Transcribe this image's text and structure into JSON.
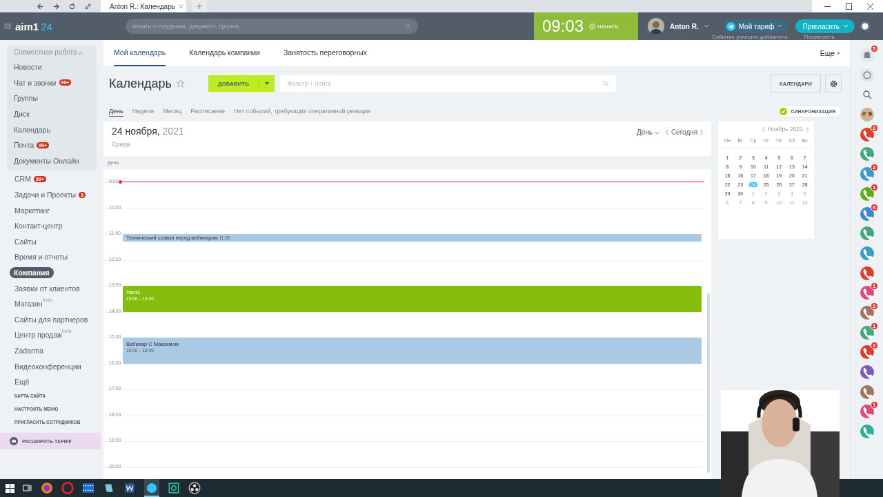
{
  "browser": {
    "tab_title": "Anton R.: Календарь"
  },
  "header": {
    "logo": "aim1",
    "logo_suffix": "24",
    "search_placeholder": "искать сотрудника, документ, прочее...",
    "timer": "09:03",
    "timer_action": "НАЧАТЬ",
    "user": "Anton R.",
    "tariff": "Мой тариф",
    "invite": "Пригласить",
    "toast": "Событие успешно добавлено",
    "toast_link": "Посмотреть"
  },
  "sidebar": {
    "group_title": "Совместная работа",
    "items": [
      {
        "label": "Новости",
        "selected": false,
        "in_group": true
      },
      {
        "label": "Чат и звонки",
        "badge": "99+",
        "selected": false,
        "in_group": true
      },
      {
        "label": "Группы",
        "selected": false,
        "in_group": true
      },
      {
        "label": "Диск",
        "selected": false,
        "in_group": true
      },
      {
        "label": "Календарь",
        "selected": false,
        "in_group": true
      },
      {
        "label": "Почта",
        "badge": "99+",
        "selected": false,
        "in_group": true
      },
      {
        "label": "Документы Онлайн",
        "selected": false,
        "in_group": true
      },
      {
        "label": "CRM",
        "badge": "99+",
        "selected": false,
        "in_group": false
      },
      {
        "label": "Задачи и Проекты",
        "badge": "3",
        "selected": false,
        "in_group": false
      },
      {
        "label": "Маркетинг",
        "selected": false,
        "in_group": false
      },
      {
        "label": "Контакт-центр",
        "selected": false,
        "in_group": false
      },
      {
        "label": "Сайты",
        "selected": false,
        "in_group": false
      },
      {
        "label": "Время и отчеты",
        "selected": false,
        "in_group": false
      },
      {
        "label": "Компания",
        "selected": true,
        "in_group": false
      },
      {
        "label": "Заявки от клиентов",
        "selected": false,
        "in_group": false
      },
      {
        "label": "Магазин",
        "tag": "beta",
        "selected": false,
        "in_group": false
      },
      {
        "label": "Сайты для партнеров",
        "selected": false,
        "in_group": false
      },
      {
        "label": "Центр продаж",
        "tag": "beta",
        "selected": false,
        "in_group": false
      },
      {
        "label": "Zadarma",
        "selected": false,
        "in_group": false
      },
      {
        "label": "Видеоконференции",
        "selected": false,
        "in_group": false
      },
      {
        "label": "Ещё",
        "selected": false,
        "in_group": false
      }
    ],
    "links": [
      "КАРТА САЙТА",
      "НАСТРОИТЬ МЕНЮ",
      "ПРИГЛАСИТЬ СОТРУДНИКОВ"
    ],
    "upgrade": "РАСШИРИТЬ ТАРИФ"
  },
  "tabs": [
    {
      "label": "Мой календарь",
      "selected": true
    },
    {
      "label": "Календарь компании",
      "selected": false
    },
    {
      "label": "Занятость переговорных",
      "selected": false
    }
  ],
  "more": "Еще",
  "toolbar": {
    "title": "Календарь",
    "add": "ДОБАВИТЬ",
    "filter_placeholder": "Фильтр + поиск",
    "calendars": "КАЛЕНДАРИ"
  },
  "views": [
    {
      "label": "День",
      "selected": true
    },
    {
      "label": "Неделя",
      "selected": false
    },
    {
      "label": "Месяц",
      "selected": false
    },
    {
      "label": "Расписание",
      "selected": false
    }
  ],
  "notice": "Нет событий, требующих оперативной реакции",
  "sync": "СИНХРОНИЗАЦИЯ",
  "day": {
    "date": "24 ноября,",
    "year": "2021",
    "weekday": "Среда",
    "view": "День",
    "today": "Сегодня",
    "section": "День",
    "hours": [
      "9:00",
      "10:00",
      "11:00",
      "12:00",
      "13:00",
      "14:00",
      "15:00",
      "16:00",
      "17:00",
      "18:00",
      "19:00",
      "20:00"
    ],
    "events": [
      {
        "title": "Технический созвон перед вебинаром",
        "time": "11:00",
        "color": "#a9c9e5"
      },
      {
        "title": "Тест1",
        "time": "13:00 – 14:00",
        "color": "#85bd0b"
      },
      {
        "title": "Вебинар С Максимом",
        "time": "15:00 – 16:00",
        "color": "#a9c9e5"
      }
    ]
  },
  "mini_calendar": {
    "month": "Ноябрь 2021",
    "weekdays": [
      "Пн",
      "Вт",
      "Ср",
      "Чт",
      "Пт",
      "Сб",
      "Вс"
    ],
    "weeks": [
      [
        {
          "day": "1",
          "other_month": false,
          "selected": false
        },
        {
          "day": "2",
          "other_month": false,
          "selected": false
        },
        {
          "day": "3",
          "other_month": false,
          "selected": false
        },
        {
          "day": "4",
          "other_month": false,
          "selected": false
        },
        {
          "day": "5",
          "other_month": false,
          "selected": false
        },
        {
          "day": "6",
          "other_month": false,
          "selected": false
        },
        {
          "day": "7",
          "other_month": false,
          "selected": false
        }
      ],
      [
        {
          "day": "8",
          "other_month": false,
          "selected": false
        },
        {
          "day": "9",
          "other_month": false,
          "selected": false
        },
        {
          "day": "10",
          "other_month": false,
          "selected": false
        },
        {
          "day": "11",
          "other_month": false,
          "selected": false
        },
        {
          "day": "12",
          "other_month": false,
          "selected": false
        },
        {
          "day": "13",
          "other_month": false,
          "selected": false
        },
        {
          "day": "14",
          "other_month": false,
          "selected": false
        }
      ],
      [
        {
          "day": "15",
          "other_month": false,
          "selected": false
        },
        {
          "day": "16",
          "other_month": false,
          "selected": false
        },
        {
          "day": "17",
          "other_month": false,
          "selected": false
        },
        {
          "day": "18",
          "other_month": false,
          "selected": false
        },
        {
          "day": "19",
          "other_month": false,
          "selected": false
        },
        {
          "day": "20",
          "other_month": false,
          "selected": false
        },
        {
          "day": "21",
          "other_month": false,
          "selected": false
        }
      ],
      [
        {
          "day": "22",
          "other_month": false,
          "selected": false
        },
        {
          "day": "23",
          "other_month": false,
          "selected": false
        },
        {
          "day": "24",
          "other_month": false,
          "selected": true
        },
        {
          "day": "25",
          "other_month": false,
          "selected": false
        },
        {
          "day": "26",
          "other_month": false,
          "selected": false
        },
        {
          "day": "27",
          "other_month": false,
          "selected": false
        },
        {
          "day": "28",
          "other_month": false,
          "selected": false
        }
      ],
      [
        {
          "day": "29",
          "other_month": false,
          "selected": false
        },
        {
          "day": "30",
          "other_month": false,
          "selected": false
        },
        {
          "day": "1",
          "other_month": true,
          "selected": false
        },
        {
          "day": "2",
          "other_month": true,
          "selected": false
        },
        {
          "day": "3",
          "other_month": true,
          "selected": false
        },
        {
          "day": "4",
          "other_month": true,
          "selected": false
        },
        {
          "day": "5",
          "other_month": true,
          "selected": false
        }
      ],
      [
        {
          "day": "6",
          "other_month": true,
          "selected": false
        },
        {
          "day": "7",
          "other_month": true,
          "selected": false
        },
        {
          "day": "8",
          "other_month": true,
          "selected": false
        },
        {
          "day": "9",
          "other_month": true,
          "selected": false
        },
        {
          "day": "10",
          "other_month": true,
          "selected": false
        },
        {
          "day": "11",
          "other_month": true,
          "selected": false
        },
        {
          "day": "12",
          "other_month": true,
          "selected": false
        }
      ]
    ]
  },
  "right_bar": {
    "notifications": "5",
    "contacts": [
      {
        "kind": "group"
      },
      {
        "kind": "call",
        "color": "#d9412d",
        "badge": "2"
      },
      {
        "kind": "call",
        "color": "#44a87a"
      },
      {
        "kind": "call",
        "color": "#3e9bc6",
        "badge": "2"
      },
      {
        "kind": "call",
        "color": "#62ab1e",
        "badge": "1"
      },
      {
        "kind": "call",
        "color": "#3a8ac8",
        "badge": "4"
      },
      {
        "kind": "call",
        "color": "#44a87a"
      },
      {
        "kind": "call",
        "color": "#3e9bc6"
      },
      {
        "kind": "call",
        "color": "#d9412d"
      },
      {
        "kind": "call",
        "color": "#e0497a",
        "badge": "1"
      },
      {
        "kind": "call",
        "color": "#a0755c",
        "badge": "2"
      },
      {
        "kind": "call",
        "color": "#44a87a",
        "badge": "1"
      },
      {
        "kind": "call",
        "color": "#d9412d",
        "badge": "2"
      },
      {
        "kind": "call",
        "color": "#7d5bbf"
      },
      {
        "kind": "call",
        "color": "#a0755c"
      },
      {
        "kind": "call",
        "color": "#e0497a",
        "badge": "1"
      },
      {
        "kind": "call",
        "color": "#2fae9e"
      }
    ]
  }
}
